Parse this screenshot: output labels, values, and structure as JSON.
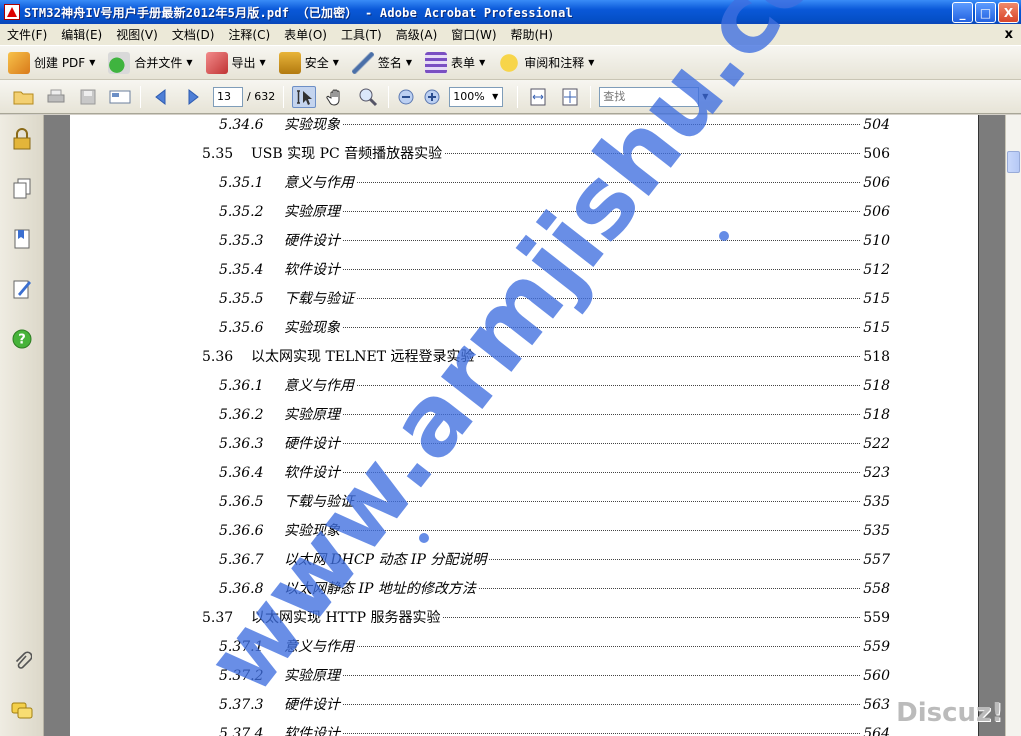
{
  "window": {
    "title": "STM32神舟IV号用户手册最新2012年5月版.pdf （已加密） - Adobe Acrobat Professional",
    "minimize": "_",
    "maximize": "□",
    "close": "X"
  },
  "menu": {
    "items": [
      "文件(F)",
      "编辑(E)",
      "视图(V)",
      "文档(D)",
      "注释(C)",
      "表单(O)",
      "工具(T)",
      "高级(A)",
      "窗口(W)",
      "帮助(H)"
    ],
    "doc_close": "x"
  },
  "toolbar": {
    "create_pdf": "创建 PDF",
    "combine": "合并文件",
    "export": "导出",
    "security": "安全",
    "sign": "签名",
    "forms": "表单",
    "review": "审阅和注释"
  },
  "nav": {
    "page_number": "13",
    "page_total": "/ 632",
    "zoom": "100%",
    "find_placeholder": "查找"
  },
  "toc": [
    {
      "num": "5.34.6",
      "text": "实验现象",
      "page": "504",
      "level": 2
    },
    {
      "num": "5.35",
      "text": "USB 实现 PC 音频播放器实验",
      "page": "506",
      "level": 1
    },
    {
      "num": "5.35.1",
      "text": "意义与作用",
      "page": "506",
      "level": 2
    },
    {
      "num": "5.35.2",
      "text": "实验原理",
      "page": "506",
      "level": 2
    },
    {
      "num": "5.35.3",
      "text": "硬件设计",
      "page": "510",
      "level": 2
    },
    {
      "num": "5.35.4",
      "text": "软件设计",
      "page": "512",
      "level": 2
    },
    {
      "num": "5.35.5",
      "text": "下载与验证",
      "page": "515",
      "level": 2
    },
    {
      "num": "5.35.6",
      "text": "实验现象",
      "page": "515",
      "level": 2
    },
    {
      "num": "5.36",
      "text": "以太网实现 TELNET 远程登录实验",
      "page": "518",
      "level": 1
    },
    {
      "num": "5.36.1",
      "text": "意义与作用",
      "page": "518",
      "level": 2
    },
    {
      "num": "5.36.2",
      "text": "实验原理",
      "page": "518",
      "level": 2
    },
    {
      "num": "5.36.3",
      "text": "硬件设计",
      "page": "522",
      "level": 2
    },
    {
      "num": "5.36.4",
      "text": "软件设计",
      "page": "523",
      "level": 2
    },
    {
      "num": "5.36.5",
      "text": "下载与验证",
      "page": "535",
      "level": 2
    },
    {
      "num": "5.36.6",
      "text": "实验现象",
      "page": "535",
      "level": 2
    },
    {
      "num": "5.36.7",
      "text": "以太网 DHCP 动态 IP 分配说明",
      "page": "557",
      "level": 2
    },
    {
      "num": "5.36.8",
      "text": "以太网静态 IP 地址的修改方法",
      "page": "558",
      "level": 2
    },
    {
      "num": "5.37",
      "text": "以太网实现 HTTP 服务器实验",
      "page": "559",
      "level": 1
    },
    {
      "num": "5.37.1",
      "text": "意义与作用",
      "page": "559",
      "level": 2
    },
    {
      "num": "5.37.2",
      "text": "实验原理",
      "page": "560",
      "level": 2
    },
    {
      "num": "5.37.3",
      "text": "硬件设计",
      "page": "563",
      "level": 2
    },
    {
      "num": "5.37.4",
      "text": "软件设计",
      "page": "564",
      "level": 2
    }
  ],
  "watermark": {
    "text": "www.armjishu.com",
    "color": "#3f6fe0"
  },
  "corner_logo": "Discuz!"
}
